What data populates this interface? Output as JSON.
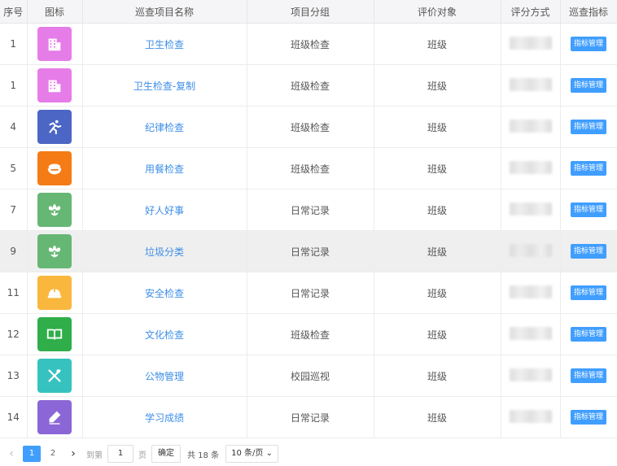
{
  "headers": [
    "序号",
    "图标",
    "巡查项目名称",
    "项目分组",
    "评价对象",
    "评分方式",
    "巡查指标"
  ],
  "rows": [
    {
      "seq": "1",
      "icon": "building-icon",
      "icon_color": "#e67ce8",
      "name": "卫生检查",
      "group": "班级检查",
      "target": "班级",
      "action": "指标管理"
    },
    {
      "seq": "1",
      "icon": "building-icon",
      "icon_color": "#e67ce8",
      "name": "卫生检查-复制",
      "group": "班级检查",
      "target": "班级",
      "action": "指标管理"
    },
    {
      "seq": "4",
      "icon": "running-person-icon",
      "icon_color": "#4b66c4",
      "name": "纪律检查",
      "group": "班级检查",
      "target": "班级",
      "action": "指标管理"
    },
    {
      "seq": "5",
      "icon": "rice-bowl-icon",
      "icon_color": "#f47b16",
      "name": "用餐检查",
      "group": "班级检查",
      "target": "班级",
      "action": "指标管理"
    },
    {
      "seq": "7",
      "icon": "flower-icon",
      "icon_color": "#66b774",
      "name": "好人好事",
      "group": "日常记录",
      "target": "班级",
      "action": "指标管理"
    },
    {
      "seq": "9",
      "icon": "flower-icon",
      "icon_color": "#66b774",
      "name": "垃圾分类",
      "group": "日常记录",
      "target": "班级",
      "action": "指标管理",
      "highlight": true
    },
    {
      "seq": "11",
      "icon": "hard-hat-icon",
      "icon_color": "#f9b73e",
      "name": "安全检查",
      "group": "日常记录",
      "target": "班级",
      "action": "指标管理"
    },
    {
      "seq": "12",
      "icon": "open-book-icon",
      "icon_color": "#2fae4a",
      "name": "文化检查",
      "group": "班级检查",
      "target": "班级",
      "action": "指标管理"
    },
    {
      "seq": "13",
      "icon": "tools-icon",
      "icon_color": "#36c3c0",
      "name": "公物管理",
      "group": "校园巡视",
      "target": "班级",
      "action": "指标管理"
    },
    {
      "seq": "14",
      "icon": "pencil-icon",
      "icon_color": "#8a66d6",
      "name": "学习成绩",
      "group": "日常记录",
      "target": "班级",
      "action": "指标管理"
    }
  ],
  "pagination": {
    "pages": [
      "1",
      "2"
    ],
    "active_page": "1",
    "goto_label": "到第",
    "goto_value": "1",
    "page_unit": "页",
    "confirm_label": "确定",
    "total_text": "共 18 条",
    "page_size": "10 条/页"
  }
}
